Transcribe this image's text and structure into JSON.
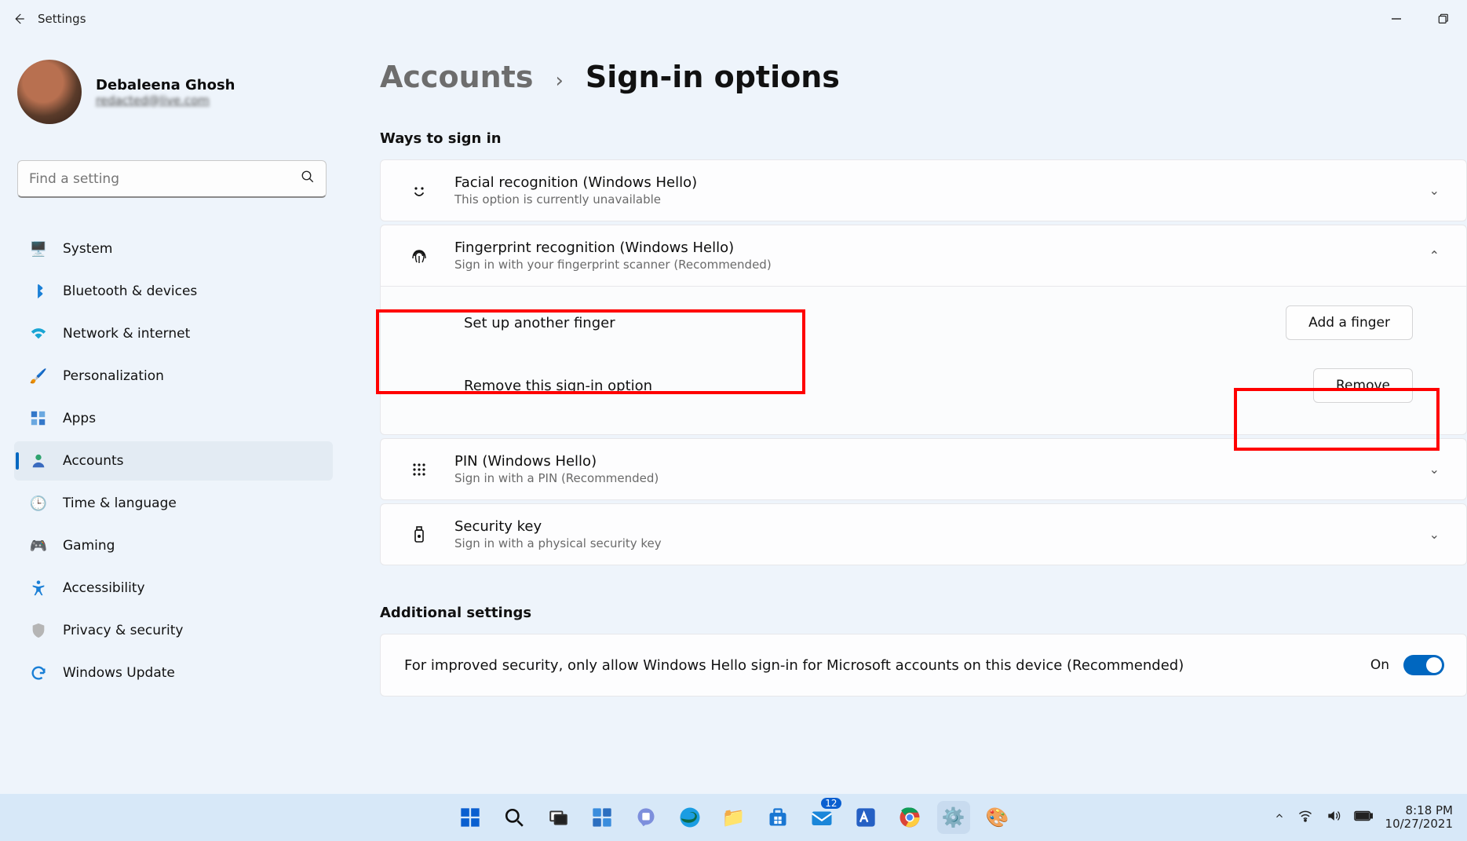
{
  "window": {
    "title": "Settings"
  },
  "profile": {
    "name": "Debaleena Ghosh",
    "email_placeholder": "redacted@live.com"
  },
  "search": {
    "placeholder": "Find a setting"
  },
  "sidebar": {
    "items": [
      {
        "label": "System",
        "icon": "monitor-icon"
      },
      {
        "label": "Bluetooth & devices",
        "icon": "bluetooth-icon"
      },
      {
        "label": "Network & internet",
        "icon": "wifi-icon"
      },
      {
        "label": "Personalization",
        "icon": "paintbrush-icon"
      },
      {
        "label": "Apps",
        "icon": "apps-icon"
      },
      {
        "label": "Accounts",
        "icon": "person-icon",
        "selected": true
      },
      {
        "label": "Time & language",
        "icon": "clock-globe-icon"
      },
      {
        "label": "Gaming",
        "icon": "gamepad-icon"
      },
      {
        "label": "Accessibility",
        "icon": "accessibility-icon"
      },
      {
        "label": "Privacy & security",
        "icon": "shield-icon"
      },
      {
        "label": "Windows Update",
        "icon": "sync-icon"
      }
    ]
  },
  "breadcrumb": {
    "parent": "Accounts",
    "current": "Sign-in options"
  },
  "sections": {
    "ways_heading": "Ways to sign in",
    "additional_heading": "Additional settings"
  },
  "signin": {
    "facial": {
      "title": "Facial recognition (Windows Hello)",
      "subtitle": "This option is currently unavailable"
    },
    "fingerprint": {
      "title": "Fingerprint recognition (Windows Hello)",
      "subtitle": "Sign in with your fingerprint scanner (Recommended)",
      "setup_label": "Set up another finger",
      "setup_button": "Add a finger",
      "remove_label": "Remove this sign-in option",
      "remove_button": "Remove"
    },
    "pin": {
      "title": "PIN (Windows Hello)",
      "subtitle": "Sign in with a PIN (Recommended)"
    },
    "security_key": {
      "title": "Security key",
      "subtitle": "Sign in with a physical security key"
    }
  },
  "additional": {
    "hello_only_label": "For improved security, only allow Windows Hello sign-in for Microsoft accounts on this device (Recommended)",
    "hello_only_state": "On"
  },
  "taskbar": {
    "mail_badge": "12",
    "time": "8:18 PM",
    "date": "10/27/2021"
  }
}
